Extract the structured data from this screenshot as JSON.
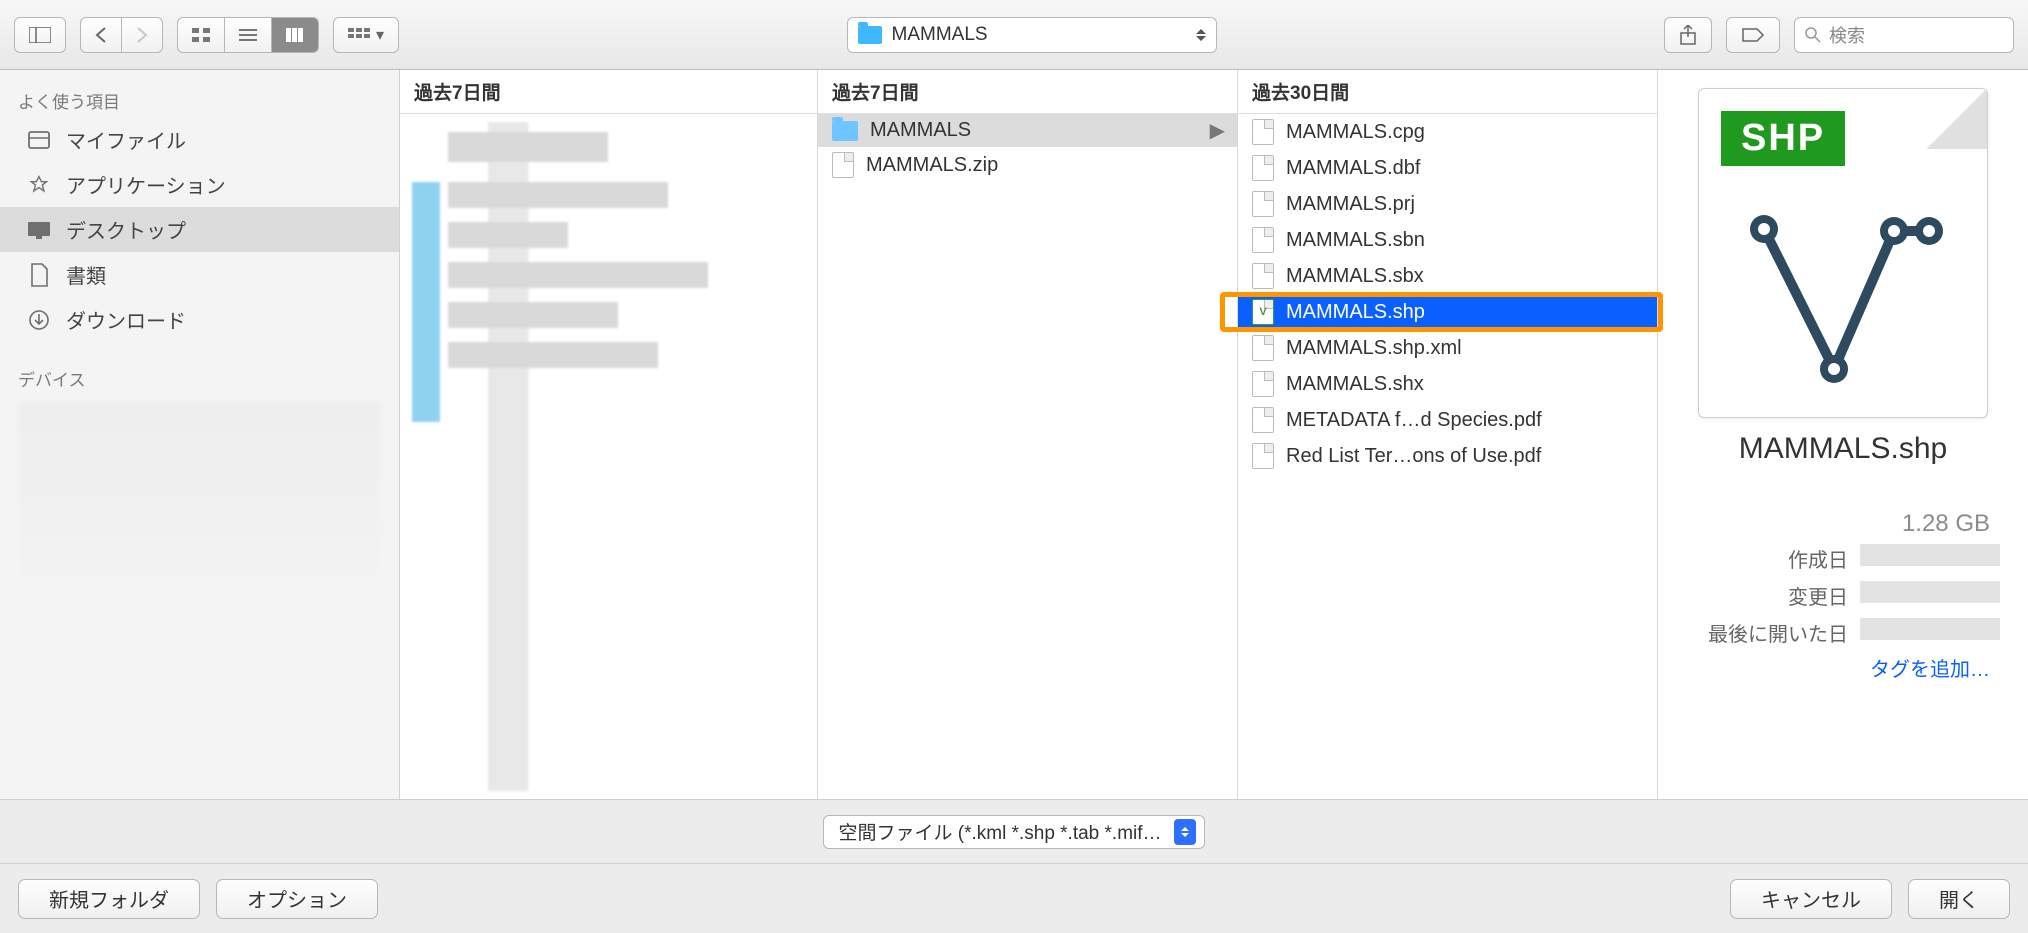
{
  "toolbar": {
    "current_folder": "MAMMALS",
    "search_placeholder": "検索"
  },
  "sidebar": {
    "favorites_header": "よく使う項目",
    "items": [
      {
        "label": "マイファイル"
      },
      {
        "label": "アプリケーション"
      },
      {
        "label": "デスクトップ"
      },
      {
        "label": "書類"
      },
      {
        "label": "ダウンロード"
      }
    ],
    "devices_header": "デバイス"
  },
  "columns": {
    "col1_header": "過去7日間",
    "col2_header": "過去7日間",
    "col3_header": "過去30日間",
    "col2_items": [
      {
        "label": "MAMMALS",
        "type": "folder",
        "selected": true,
        "has_children": true
      },
      {
        "label": "MAMMALS.zip",
        "type": "file"
      }
    ],
    "col3_items": [
      {
        "label": "MAMMALS.cpg"
      },
      {
        "label": "MAMMALS.dbf"
      },
      {
        "label": "MAMMALS.prj"
      },
      {
        "label": "MAMMALS.sbn"
      },
      {
        "label": "MAMMALS.sbx"
      },
      {
        "label": "MAMMALS.shp",
        "selected": true,
        "highlighted": true,
        "green": true
      },
      {
        "label": "MAMMALS.shp.xml"
      },
      {
        "label": "MAMMALS.shx"
      },
      {
        "label": "METADATA f…d Species.pdf"
      },
      {
        "label": "Red List Ter…ons of Use.pdf"
      }
    ]
  },
  "preview": {
    "badge": "SHP",
    "filename": "MAMMALS.shp",
    "size": "1.28 GB",
    "meta_labels": {
      "created": "作成日",
      "modified": "変更日",
      "opened": "最後に開いた日"
    },
    "add_tag": "タグを追加…"
  },
  "filter": {
    "label": "空間ファイル (*.kml *.shp *.tab *.mif…"
  },
  "footer": {
    "new_folder": "新規フォルダ",
    "options": "オプション",
    "cancel": "キャンセル",
    "open": "開く"
  }
}
